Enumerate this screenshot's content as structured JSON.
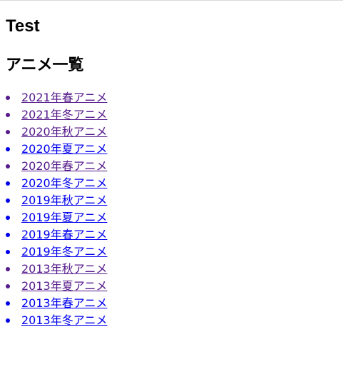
{
  "page": {
    "title": "Test",
    "subtitle": "アニメ一覧"
  },
  "colors": {
    "visited_link": "#551a8b",
    "unvisited_link": "#0000ee"
  },
  "links": [
    {
      "label": "2021年春アニメ",
      "visited": true
    },
    {
      "label": "2021年冬アニメ",
      "visited": true
    },
    {
      "label": "2020年秋アニメ",
      "visited": true
    },
    {
      "label": "2020年夏アニメ",
      "visited": false
    },
    {
      "label": "2020年春アニメ",
      "visited": true
    },
    {
      "label": "2020年冬アニメ",
      "visited": false
    },
    {
      "label": "2019年秋アニメ",
      "visited": false
    },
    {
      "label": "2019年夏アニメ",
      "visited": false
    },
    {
      "label": "2019年春アニメ",
      "visited": false
    },
    {
      "label": "2019年冬アニメ",
      "visited": false
    },
    {
      "label": "2013年秋アニメ",
      "visited": true
    },
    {
      "label": "2013年夏アニメ",
      "visited": true
    },
    {
      "label": "2013年春アニメ",
      "visited": false
    },
    {
      "label": "2013年冬アニメ",
      "visited": false
    }
  ]
}
